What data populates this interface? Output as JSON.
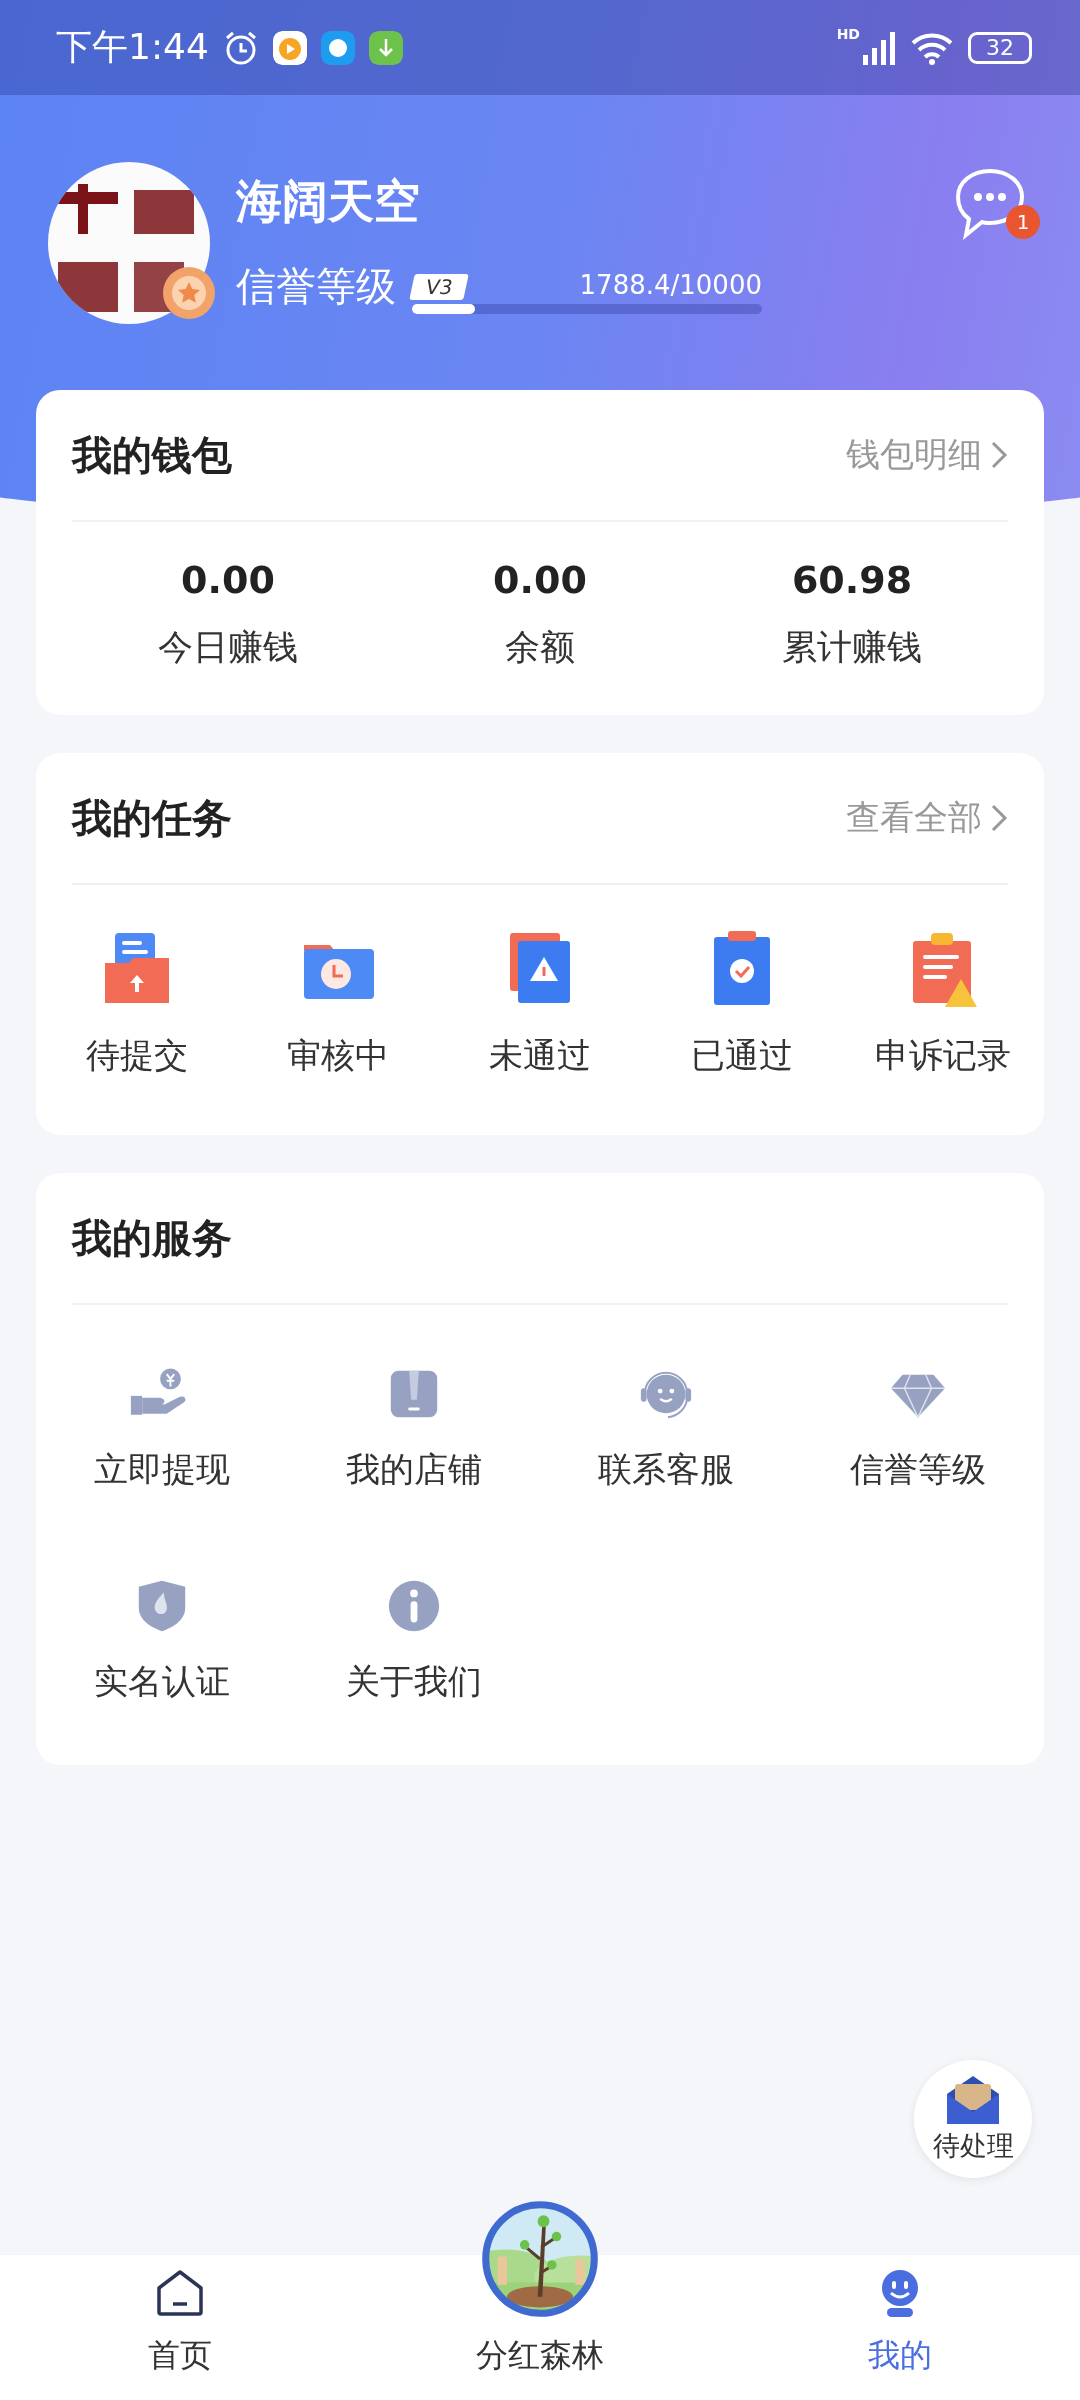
{
  "status_bar": {
    "time": "下午1:44",
    "network_label": "HD",
    "battery": "32"
  },
  "profile": {
    "name": "海阔天空",
    "credit_label": "信誉等级",
    "level_badge": "V3",
    "progress": {
      "level": 0.18,
      "reading": "1788.4/10000"
    },
    "message_badge": "1"
  },
  "wallet": {
    "title": "我的钱包",
    "link": "钱包明细",
    "stats": [
      {
        "value": "0.00",
        "label": "今日赚钱"
      },
      {
        "value": "0.00",
        "label": "余额"
      },
      {
        "value": "60.98",
        "label": "累计赚钱"
      }
    ]
  },
  "tasks": {
    "title": "我的任务",
    "link": "查看全部",
    "items": [
      {
        "label": "待提交",
        "kind": "pending"
      },
      {
        "label": "审核中",
        "kind": "review"
      },
      {
        "label": "未通过",
        "kind": "rejected"
      },
      {
        "label": "已通过",
        "kind": "approved"
      },
      {
        "label": "申诉记录",
        "kind": "appeal"
      }
    ]
  },
  "services": {
    "title": "我的服务",
    "items": [
      {
        "label": "立即提现",
        "kind": "withdraw"
      },
      {
        "label": "我的店铺",
        "kind": "shop"
      },
      {
        "label": "联系客服",
        "kind": "support"
      },
      {
        "label": "信誉等级",
        "kind": "credit"
      },
      {
        "label": "实名认证",
        "kind": "verify"
      },
      {
        "label": "关于我们",
        "kind": "about"
      }
    ]
  },
  "floating_button": {
    "label": "待处理"
  },
  "bottom_nav": [
    {
      "label": "首页",
      "kind": "home",
      "selected": false
    },
    {
      "label": "分红森林",
      "kind": "forest",
      "selected": false
    },
    {
      "label": "我的",
      "kind": "me",
      "selected": true
    }
  ]
}
